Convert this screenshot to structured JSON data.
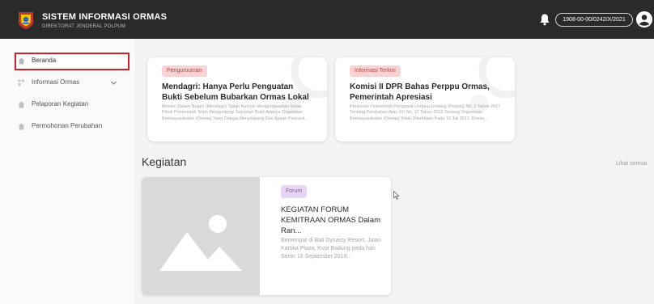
{
  "header": {
    "title": "SISTEM INFORMASI ORMAS",
    "subtitle": "DIREKTORAT JENDERAL POLPUM",
    "user_id": "1908-00-00/0242/X/2021",
    "bell_icon": "bell-icon",
    "avatar_icon": "user-avatar-icon"
  },
  "sidebar": {
    "items": [
      {
        "label": "Beranda",
        "icon": "home-icon",
        "active": true
      },
      {
        "label": "Informasi Ormas",
        "icon": "info-icon",
        "expandable": true
      },
      {
        "label": "Pelaporan Kegiatan",
        "icon": "report-icon"
      },
      {
        "label": "Permohonan Perubahan",
        "icon": "request-icon"
      }
    ]
  },
  "news": [
    {
      "badge": "Pengumuman",
      "badge_color": "#f7d3d3",
      "title": "Mendagri: Hanya Perlu Penguatan Bukti Sebelum Bubarkan Ormas Lokal",
      "desc": "Menteri Dalam Negeri (Mendagri) Tjahjo Kumolo Mengungkapkan Kalau Pihak Pemerintah Telah Mengantongi Sejumlah Bukti Adanya Organisasi Kemasyarakatan (Ormas) Yang Diduga Menyimpang Dari Ajaran Pancasil..."
    },
    {
      "badge": "Informasi Terkini",
      "badge_color": "#f7d3d3",
      "title": "Komisi II DPR Bahas Perppu Ormas, Pemerintah Apresiasi",
      "desc": "Peraturan Pemerintah Pengganti Undang-Undang (Perppu) No. 2 Tahun 2017 Tentang Perubahan Atas UU No. 17 Tahun 2013 Tentang Organisasi Kemasyarakatan (Ormas) Telah Diterbitkan Pada 10 Juli 2017. Komis..."
    }
  ],
  "kegiatan": {
    "section_title": "Kegiatan",
    "see_all": "Lihat semua",
    "event": {
      "badge": "Forum",
      "badge_color": "#e6d8f2",
      "title": "KEGIATAN FORUM KEMITRAAN ORMAS Dalam Ran...",
      "desc": "Bertempat di Bali Dynasty Resort, Jalan Kartika Plaza, Kuta Badung pada hari Senin 16 September 2019...",
      "image_icon": "image-placeholder-icon"
    }
  },
  "colors": {
    "topbar": "#2a2a2a",
    "active_border": "#d0202a",
    "background": "#f4f4f4"
  }
}
